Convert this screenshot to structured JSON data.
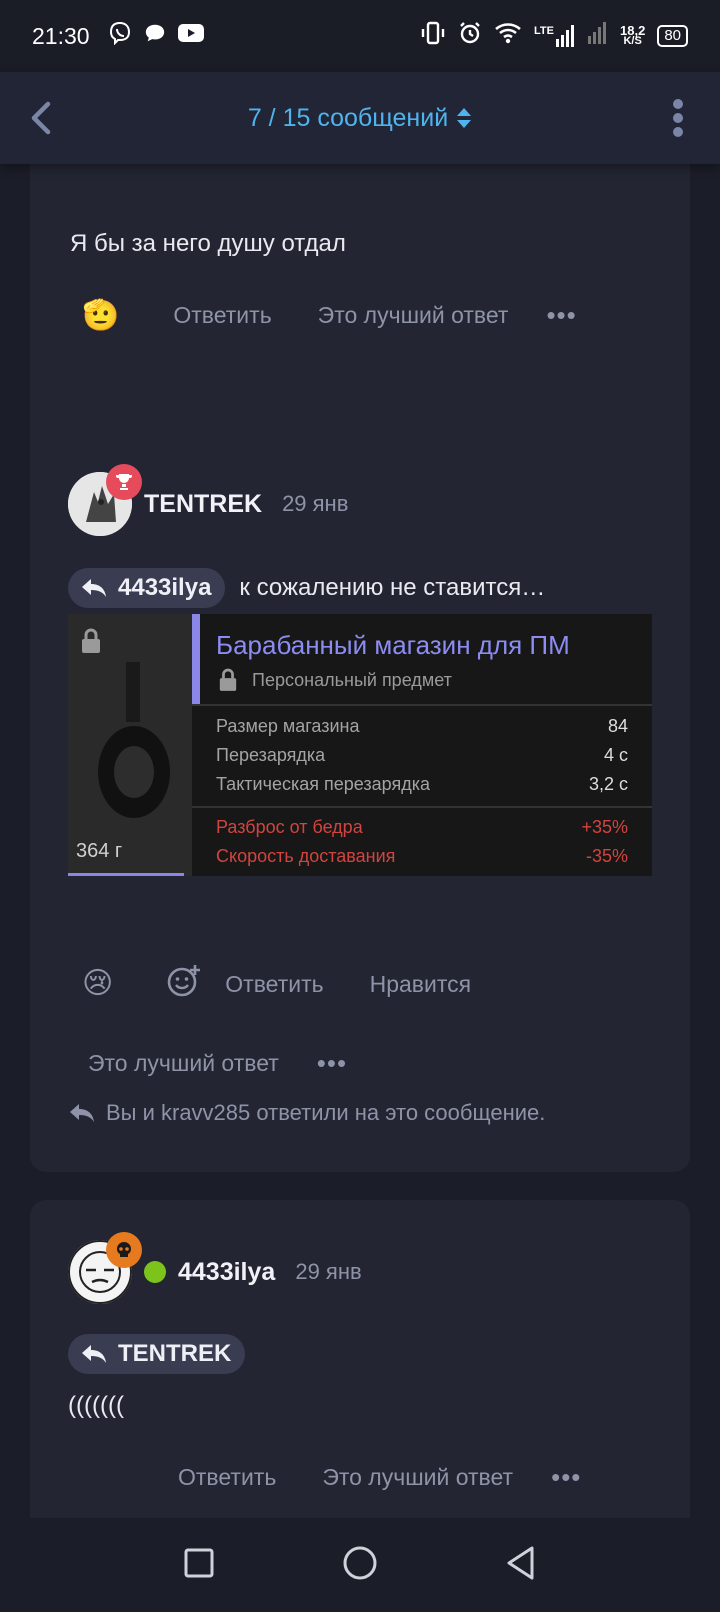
{
  "status_bar": {
    "time": "21:30",
    "network_type": "LTE",
    "speed_value": "18,2",
    "speed_unit": "K/S",
    "battery": "80"
  },
  "header": {
    "title": "7 / 15 сообщений"
  },
  "messages": [
    {
      "text": "Я бы за него душу отдал",
      "actions": {
        "reply": "Ответить",
        "best": "Это лучший ответ"
      }
    },
    {
      "author": "TENTREK",
      "date": "29 янв",
      "reply_to": "4433ilya",
      "text": "к сожалению не ставится…",
      "item_card": {
        "title": "Барабанный магазин для ПМ",
        "subtitle": "Персональный предмет",
        "weight": "364 г",
        "stats": [
          {
            "label": "Размер магазина",
            "value": "84"
          },
          {
            "label": "Перезарядка",
            "value": "4 с"
          },
          {
            "label": "Тактическая перезарядка",
            "value": "3,2 с"
          }
        ],
        "penalties": [
          {
            "label": "Разброс от бедра",
            "value": "+35%"
          },
          {
            "label": "Скорость доставания",
            "value": "-35%"
          }
        ]
      },
      "actions": {
        "reply": "Ответить",
        "like": "Нравится",
        "best": "Это лучший ответ"
      },
      "replied_note": "Вы и kravv285 ответили на это сообщение."
    },
    {
      "author": "4433ilya",
      "date": "29 янв",
      "reply_to": "TENTREK",
      "text": "(((((((",
      "actions": {
        "reply": "Ответить",
        "best": "Это лучший ответ"
      }
    }
  ]
}
